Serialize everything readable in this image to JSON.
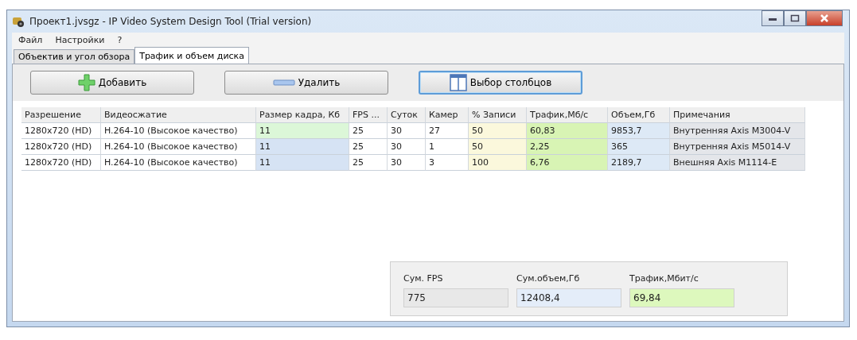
{
  "window": {
    "title": "Проект1.jvsgz - IP Video System Design Tool (Trial version)"
  },
  "menu": [
    "Файл",
    "Настройки",
    "?"
  ],
  "tabs": [
    {
      "label": "Объектив и угол обзора",
      "selected": false
    },
    {
      "label": "Трафик и объем диска",
      "selected": true
    }
  ],
  "toolbar": [
    {
      "label": "Добавить",
      "kind": "add",
      "focused": false
    },
    {
      "label": "Удалить",
      "kind": "remove",
      "focused": false
    },
    {
      "label": "Выбор столбцов",
      "kind": "columns",
      "focused": true
    }
  ],
  "table": {
    "columns": [
      {
        "label": "Разрешение"
      },
      {
        "label": "Видеосжатие"
      },
      {
        "label": "Размер кадра, Кб"
      },
      {
        "label": "FPS ..."
      },
      {
        "label": "Суток"
      },
      {
        "label": "Камер"
      },
      {
        "label": "% Записи",
        "color": "#fbf8dc"
      },
      {
        "label": "Трафик,Мб/с",
        "color": "#d8f4b4"
      },
      {
        "label": "Объем,Гб",
        "color": "#dde9f6"
      },
      {
        "label": "Примечания",
        "color": "#e4e6ea"
      }
    ],
    "rows": [
      {
        "cells": [
          {
            "text": "1280x720 (HD)"
          },
          {
            "text": "H.264-10 (Высокое качество)"
          },
          {
            "text": "11",
            "color": "#dcf7d8"
          },
          {
            "text": "25"
          },
          {
            "text": "30"
          },
          {
            "text": "27"
          },
          {
            "text": "50"
          },
          {
            "text": "60,83"
          },
          {
            "text": "9853,7"
          },
          {
            "text": "Внутренняя Axis M3004-V"
          }
        ]
      },
      {
        "cells": [
          {
            "text": "1280x720 (HD)"
          },
          {
            "text": "H.264-10 (Высокое качество)"
          },
          {
            "text": "11",
            "color": "#d6e3f4"
          },
          {
            "text": "25"
          },
          {
            "text": "30"
          },
          {
            "text": "1"
          },
          {
            "text": "50"
          },
          {
            "text": "2,25"
          },
          {
            "text": "365"
          },
          {
            "text": "Внутренняя Axis M5014-V"
          }
        ]
      },
      {
        "cells": [
          {
            "text": "1280x720 (HD)"
          },
          {
            "text": "H.264-10 (Высокое качество)"
          },
          {
            "text": "11",
            "color": "#d6e3f4"
          },
          {
            "text": "25"
          },
          {
            "text": "30"
          },
          {
            "text": "3"
          },
          {
            "text": "100"
          },
          {
            "text": "6,76"
          },
          {
            "text": "2189,7"
          },
          {
            "text": "Внешняя Axis M1114-E"
          }
        ]
      }
    ]
  },
  "summary": [
    {
      "label": "Сум. FPS",
      "value": "775",
      "color": "#e8e8e8"
    },
    {
      "label": "Сум.объем,Гб",
      "value": "12408,4",
      "color": "#e4edf9"
    },
    {
      "label": "Трафик,Мбит/с",
      "value": "69,84",
      "color": "#ddf8bd"
    }
  ]
}
